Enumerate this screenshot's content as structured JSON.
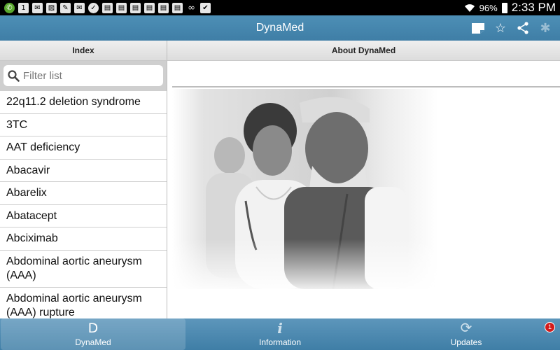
{
  "status_bar": {
    "battery_pct": "96%",
    "time": "2:33 PM",
    "notification_icons": [
      "phone-icon",
      "calendar-icon",
      "mail-icon",
      "gallery-icon",
      "clean-icon",
      "email-icon",
      "check-icon",
      "doc-icon",
      "doc-icon",
      "doc-icon",
      "doc-icon",
      "doc-icon",
      "doc-icon",
      "link-icon",
      "clipboard-icon"
    ],
    "calendar_day": "1"
  },
  "appbar": {
    "title": "DynaMed",
    "actions": [
      "notes-icon",
      "star-icon",
      "share-icon",
      "sync-icon"
    ]
  },
  "columns": {
    "left_header": "Index",
    "right_header": "About DynaMed"
  },
  "filter": {
    "placeholder": "Filter list",
    "value": ""
  },
  "index_list": [
    "22q11.2 deletion syndrome",
    "3TC",
    "AAT deficiency",
    "Abacavir",
    "Abarelix",
    "Abatacept",
    "Abciximab",
    "Abdominal aortic aneurysm (AAA)",
    "Abdominal aortic aneurysm (AAA) rupture"
  ],
  "bottom_nav": {
    "tabs": [
      {
        "label": "DynaMed",
        "icon": "dynamed-icon",
        "active": true
      },
      {
        "label": "Information",
        "icon": "info-icon",
        "active": false
      },
      {
        "label": "Updates",
        "icon": "refresh-icon",
        "active": false,
        "badge": "1"
      }
    ]
  },
  "colors": {
    "accent": "#4282aa",
    "badge": "#d21b1b"
  }
}
